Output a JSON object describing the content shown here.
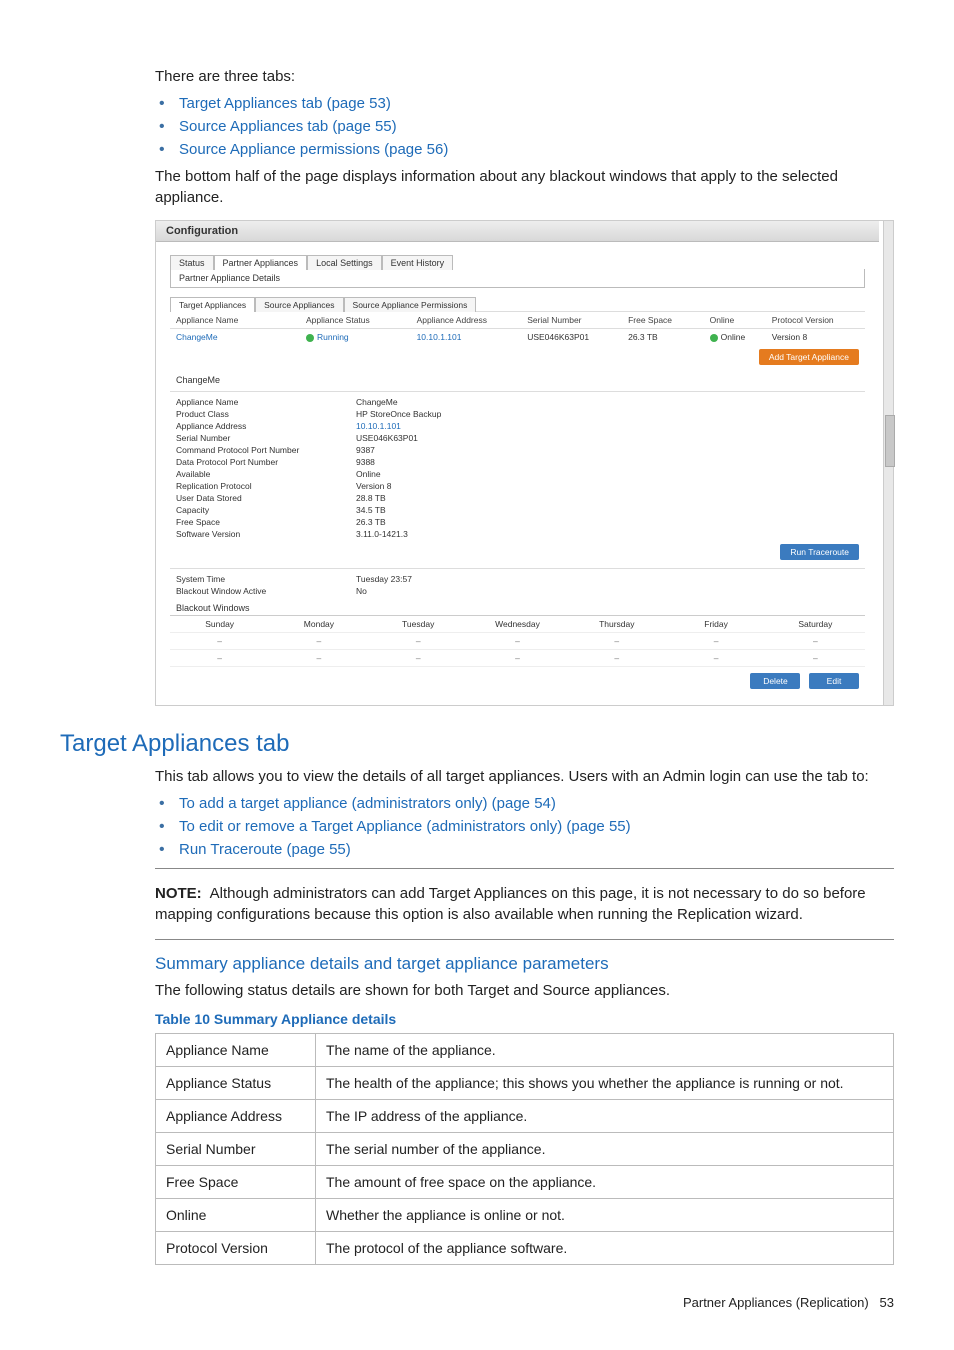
{
  "intro": {
    "tabs_sentence": "There are three tabs:",
    "tabs_links": [
      "Target Appliances tab (page 53)",
      "Source Appliances tab (page 55)",
      "Source Appliance permissions (page 56)"
    ],
    "bottom_para": "The bottom half of the page displays information about any blackout windows that apply to the selected appliance."
  },
  "figure": {
    "title": "Configuration",
    "outer_tabs": [
      "Status",
      "Partner Appliances",
      "Local Settings",
      "Event History"
    ],
    "outer_active_index": 1,
    "panel_label": "Partner Appliance Details",
    "inner_tabs": [
      "Target Appliances",
      "Source Appliances",
      "Source Appliance Permissions"
    ],
    "inner_active_index": 0,
    "grid_headers": [
      "Appliance Name",
      "Appliance Status",
      "Appliance Address",
      "Serial Number",
      "Free Space",
      "Online",
      "Protocol Version"
    ],
    "grid_row": {
      "name": "ChangeMe",
      "status": "Running",
      "address": "10.10.1.101",
      "serial": "USE046K63P01",
      "free_space": "26.3 TB",
      "online": "Online",
      "protocol": "Version 8"
    },
    "add_button": "Add Target Appliance",
    "details_heading": "ChangeMe",
    "details": [
      {
        "k": "Appliance Name",
        "v": "ChangeMe"
      },
      {
        "k": "Product Class",
        "v": "HP StoreOnce Backup"
      },
      {
        "k": "Appliance Address",
        "v": "10.10.1.101",
        "blue": true
      },
      {
        "k": "Serial Number",
        "v": "USE046K63P01"
      },
      {
        "k": "Command Protocol Port Number",
        "v": "9387"
      },
      {
        "k": "Data Protocol Port Number",
        "v": "9388"
      },
      {
        "k": "Available",
        "v": "Online"
      },
      {
        "k": "Replication Protocol",
        "v": "Version 8"
      },
      {
        "k": "User Data Stored",
        "v": "28.8 TB"
      },
      {
        "k": "Capacity",
        "v": "34.5 TB"
      },
      {
        "k": "Free Space",
        "v": "26.3 TB"
      },
      {
        "k": "Software Version",
        "v": "3.11.0-1421.3"
      }
    ],
    "traceroute_button": "Run Traceroute",
    "time_rows": [
      {
        "k": "System Time",
        "v": "Tuesday 23:57"
      },
      {
        "k": "Blackout Window Active",
        "v": "No"
      }
    ],
    "blackout_label": "Blackout Windows",
    "days": [
      "Sunday",
      "Monday",
      "Tuesday",
      "Wednesday",
      "Thursday",
      "Friday",
      "Saturday"
    ],
    "dash": "–",
    "delete_button": "Delete",
    "edit_button": "Edit"
  },
  "section": {
    "heading": "Target Appliances tab",
    "para": "This tab allows you to view the details of all target appliances. Users with an Admin login can use the tab to:",
    "links": [
      "To add a target appliance (administrators only) (page 54)",
      "To edit or remove a Target Appliance (administrators only) (page 55)",
      "Run Traceroute (page 55)"
    ],
    "note_label": "NOTE:",
    "note_text": "Although administrators can add Target Appliances on this page, it is not necessary to do so before mapping configurations because this option is also available when running the Replication wizard.",
    "sub_heading": "Summary appliance details and target appliance parameters",
    "sub_para": "The following status details are shown for both Target and Source appliances.",
    "table_caption": "Table 10 Summary Appliance details",
    "table_rows": [
      {
        "k": "Appliance Name",
        "v": "The name of the appliance."
      },
      {
        "k": "Appliance Status",
        "v": "The health of the appliance; this shows you whether the appliance is running or not."
      },
      {
        "k": "Appliance Address",
        "v": "The IP address of the appliance."
      },
      {
        "k": "Serial Number",
        "v": "The serial number of the appliance."
      },
      {
        "k": "Free Space",
        "v": "The amount of free space on the appliance."
      },
      {
        "k": "Online",
        "v": "Whether the appliance is online or not."
      },
      {
        "k": "Protocol Version",
        "v": "The protocol of the appliance software."
      }
    ]
  },
  "footer": {
    "text": "Partner Appliances (Replication)",
    "page": "53"
  }
}
